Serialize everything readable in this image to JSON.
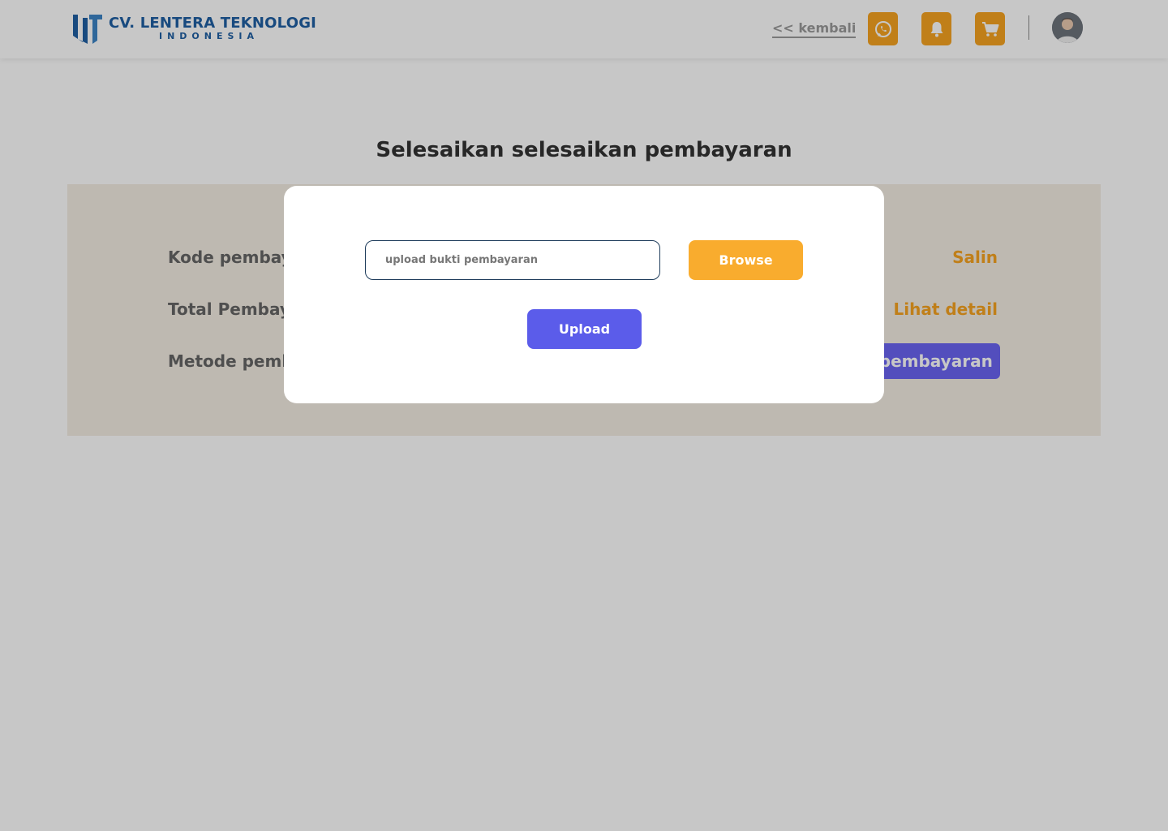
{
  "header": {
    "logo_title": "CV. LENTERA TEKNOLOGI",
    "logo_subtitle": "INDONESIA",
    "back_label": "<< kembali",
    "icons": [
      "whatsapp-icon",
      "bell-icon",
      "cart-icon"
    ],
    "accent_color": "#f6a321"
  },
  "page": {
    "title": "Selesaikan selesaikan pembayaran",
    "rows": [
      {
        "label": "Kode pembayaran",
        "action": "Salin"
      },
      {
        "label": "Total Pembayaran",
        "action": "Lihat detail"
      },
      {
        "label": "Metode pembayaran",
        "action": "Metode pembayaran"
      }
    ]
  },
  "modal": {
    "input_placeholder": "upload bukti pembayaran",
    "browse_label": "Browse",
    "upload_label": "Upload",
    "browse_color": "#f9ac2e",
    "upload_color": "#5b5cea"
  }
}
